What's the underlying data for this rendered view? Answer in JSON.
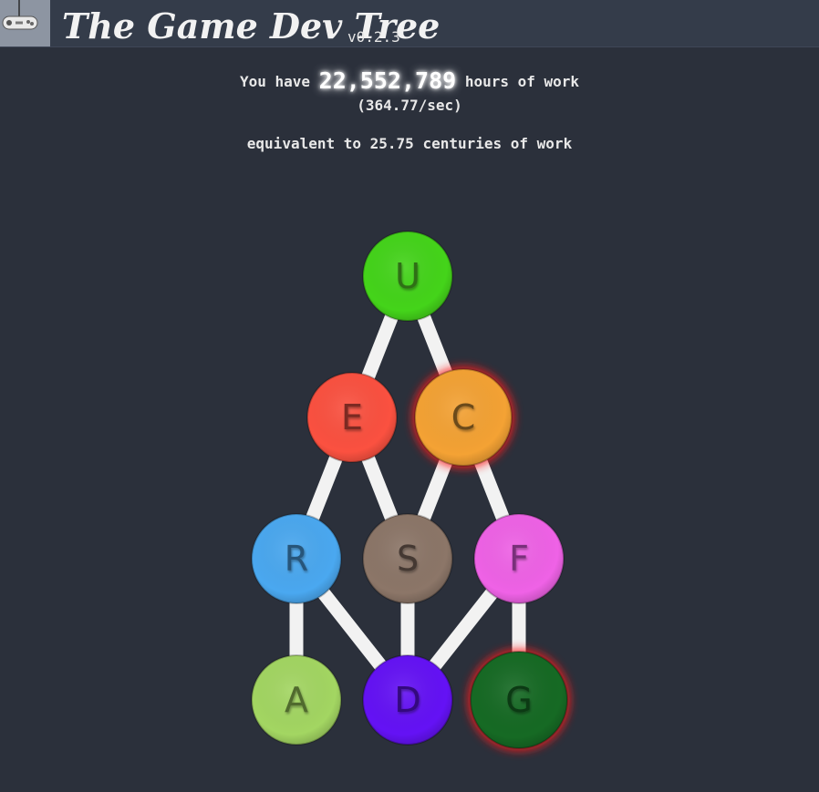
{
  "header": {
    "title": "The Game Dev Tree",
    "version": "v0.2.3",
    "logo_icon": "game-controller-icon"
  },
  "resources": {
    "prefix": "You have",
    "points": "22,552,789",
    "suffix": "hours of work",
    "rate": "(364.77/sec)",
    "equivalent": "equivalent to 25.75 centuries of work"
  },
  "tree": {
    "nodes": [
      {
        "id": "U",
        "label": "U",
        "color": "#44d41a",
        "text_color": "#2f6f16",
        "glow": false
      },
      {
        "id": "E",
        "label": "E",
        "color": "#fb5140",
        "text_color": "#7c2a22",
        "glow": false
      },
      {
        "id": "C",
        "label": "C",
        "color": "#f4a234",
        "text_color": "#6b4a1a",
        "glow": true
      },
      {
        "id": "R",
        "label": "R",
        "color": "#4aa8f0",
        "text_color": "#27557a",
        "glow": false
      },
      {
        "id": "S",
        "label": "S",
        "color": "#8c7668",
        "text_color": "#443832",
        "glow": false
      },
      {
        "id": "F",
        "label": "F",
        "color": "#ef62e6",
        "text_color": "#79307a",
        "glow": false
      },
      {
        "id": "A",
        "label": "A",
        "color": "#a3d662",
        "text_color": "#506a2e",
        "glow": false
      },
      {
        "id": "D",
        "label": "D",
        "color": "#6412f5",
        "text_color": "#34097e",
        "glow": false
      },
      {
        "id": "G",
        "label": "G",
        "color": "#166a24",
        "text_color": "#0c3a14",
        "glow": true
      }
    ],
    "branches": [
      {
        "from": "U",
        "to": "E"
      },
      {
        "from": "U",
        "to": "C"
      },
      {
        "from": "E",
        "to": "R"
      },
      {
        "from": "E",
        "to": "S"
      },
      {
        "from": "C",
        "to": "S"
      },
      {
        "from": "C",
        "to": "F"
      },
      {
        "from": "R",
        "to": "A"
      },
      {
        "from": "R",
        "to": "D"
      },
      {
        "from": "S",
        "to": "D"
      },
      {
        "from": "F",
        "to": "D"
      },
      {
        "from": "F",
        "to": "G"
      }
    ]
  }
}
